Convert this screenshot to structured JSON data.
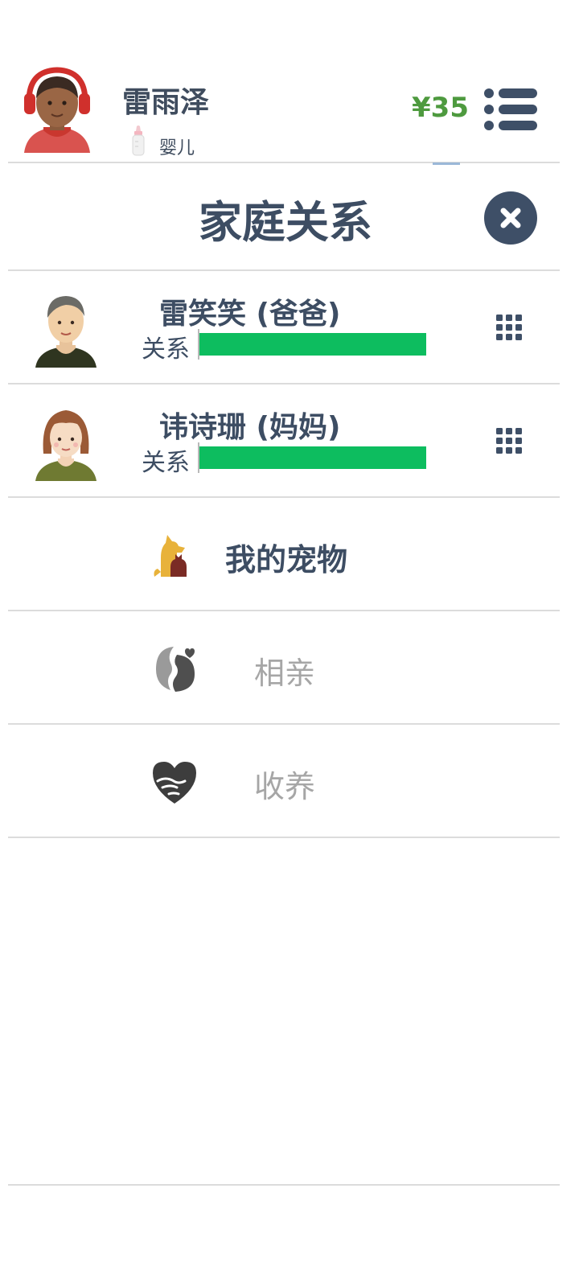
{
  "player": {
    "name": "雷雨泽",
    "life_stage": "婴儿",
    "money": "¥35"
  },
  "modal": {
    "title": "家庭关系"
  },
  "relatives": [
    {
      "name": "雷笑笑 (爸爸)",
      "relationship_label": "关系",
      "relationship_level": 1.0
    },
    {
      "name": "讳诗珊 (妈妈)",
      "relationship_label": "关系",
      "relationship_level": 1.0
    }
  ],
  "actions": [
    {
      "label": "我的宠物",
      "icon": "pet-icon",
      "enabled": true
    },
    {
      "label": "相亲",
      "icon": "dating-icon",
      "enabled": false
    },
    {
      "label": "收养",
      "icon": "adopt-heart-icon",
      "enabled": false
    }
  ],
  "colors": {
    "money": "#4e9a3f",
    "relationship_bar": "#0dbd5f",
    "primary_text": "#3d4d63",
    "disabled_text": "#a6a6a6",
    "close_button": "#3e4f67"
  }
}
